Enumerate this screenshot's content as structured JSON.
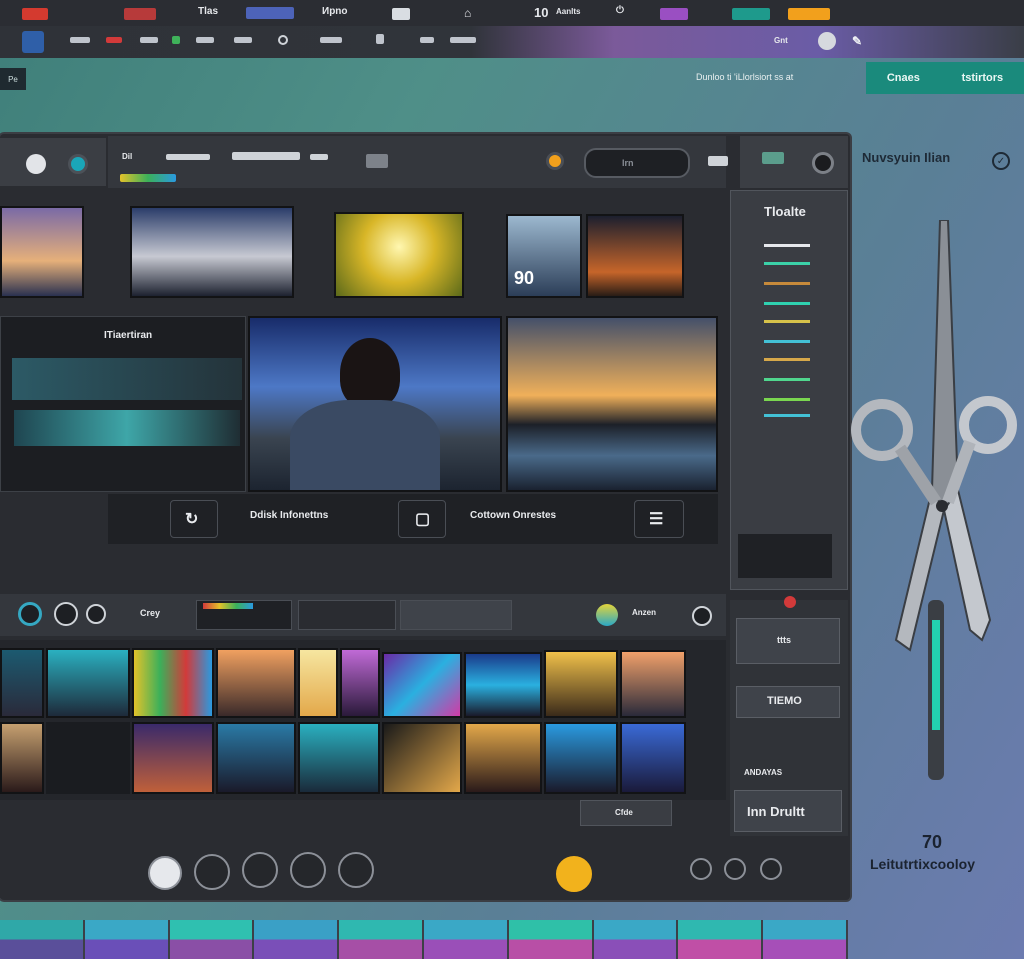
{
  "topbar": {
    "items": [
      "Tlas",
      "Иpno",
      "10",
      "Aanlts"
    ],
    "second_row": [
      "Gnt"
    ]
  },
  "status": {
    "left": "Pe",
    "text": "Dunloo ti 'iLlorlsiort ss at",
    "badge_left": "Cnaes",
    "badge_right": "tstirtors"
  },
  "brand": {
    "title": "Nuvsyuin Ilian",
    "bottom_title": "Leitutrtixcooloy",
    "bottom_num": "70"
  },
  "header": {
    "labels": [
      "Dil"
    ],
    "rec_label": "lrn"
  },
  "side": {
    "title": "Tloalte",
    "btn1": "ttts",
    "btn2": "TIEMO",
    "btn3": "ANDAYAS",
    "btn4": "Inn Drultt"
  },
  "midrow": {
    "left_label": "ITiaertiran",
    "timecode": "90",
    "bottom_left": "Ddisk Infonettns",
    "bottom_right": "Cottown Onrestes"
  },
  "toolbar": {
    "left": "Crey",
    "right": "Anzen"
  },
  "editor_bottom": {
    "label": "Cfde"
  },
  "colors": {
    "accent_teal": "#1a8a7c",
    "panel": "#2a2c31",
    "orange": "#f2a01c"
  },
  "icons": [
    "scissors-icon",
    "play-icon",
    "lock-icon",
    "crop-icon",
    "square-icon",
    "record-icon",
    "settings-icon"
  ]
}
